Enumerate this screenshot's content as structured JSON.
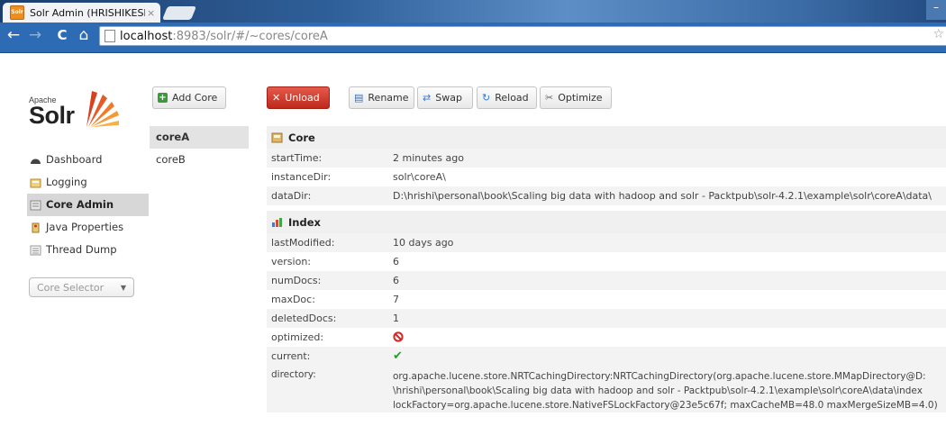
{
  "browser": {
    "tab_title": "Solr Admin (HRISHIKESHL",
    "tab_close": "×",
    "url_host": "localhost",
    "url_rest": ":8983/solr/#/~cores/coreA",
    "back": "←",
    "forward": "→",
    "reload": "C",
    "home": "⌂",
    "star": "☆"
  },
  "logo": {
    "apache": "Apache",
    "solr": "Solr"
  },
  "sidebar": {
    "items": [
      {
        "label": "Dashboard",
        "icon": "dashboard-icon"
      },
      {
        "label": "Logging",
        "icon": "logging-icon"
      },
      {
        "label": "Core Admin",
        "icon": "core-admin-icon",
        "active": true
      },
      {
        "label": "Java Properties",
        "icon": "java-properties-icon"
      },
      {
        "label": "Thread Dump",
        "icon": "thread-dump-icon"
      }
    ],
    "core_selector": "Core Selector"
  },
  "actions": {
    "add_core": "Add Core",
    "unload": "Unload",
    "rename": "Rename",
    "swap": "Swap",
    "reload": "Reload",
    "optimize": "Optimize"
  },
  "cores": [
    "coreA",
    "coreB"
  ],
  "core_section": {
    "title": "Core",
    "rows": [
      {
        "key": "startTime:",
        "value": "2 minutes ago"
      },
      {
        "key": "instanceDir:",
        "value": "solr\\coreA\\"
      },
      {
        "key": "dataDir:",
        "value": "D:\\hrishi\\personal\\book\\Scaling big data with hadoop and solr - Packtpub\\solr-4.2.1\\example\\solr\\coreA\\data\\"
      }
    ]
  },
  "index_section": {
    "title": "Index",
    "rows": [
      {
        "key": "lastModified:",
        "value": "10 days ago"
      },
      {
        "key": "version:",
        "value": "6"
      },
      {
        "key": "numDocs:",
        "value": "6"
      },
      {
        "key": "maxDoc:",
        "value": "7"
      },
      {
        "key": "deletedDocs:",
        "value": "1"
      }
    ],
    "optimized_label": "optimized:",
    "optimized_icon": "not-optimized-icon",
    "current_label": "current:",
    "current_icon": "current-check-icon",
    "directory_label": "directory:",
    "directory_lines": [
      "org.apache.lucene.store.NRTCachingDirectory:NRTCachingDirectory(org.apache.lucene.store.MMapDirectory@D:",
      "\\hrishi\\personal\\book\\Scaling big data with hadoop and solr - Packtpub\\solr-4.2.1\\example\\solr\\coreA\\data\\index",
      "lockFactory=org.apache.lucene.store.NativeFSLockFactory@23e5c67f; maxCacheMB=48.0 maxMergeSizeMB=4.0)"
    ]
  },
  "colors": {
    "accent_red": "#c0281c",
    "active_bg": "#d7d7d7",
    "ok_green": "#2b9a2b"
  }
}
